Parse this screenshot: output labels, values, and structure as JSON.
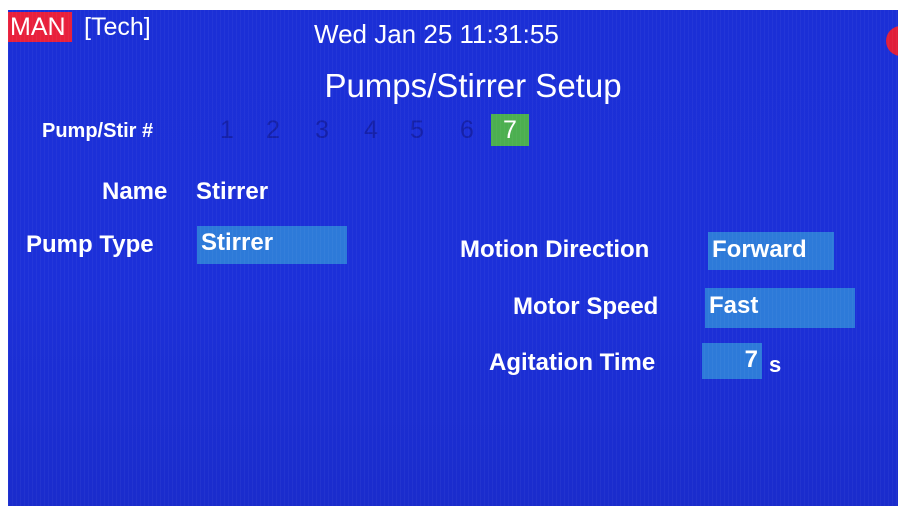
{
  "status_bar": {
    "mode": "MAN",
    "user": "[Tech]",
    "datetime": "Wed Jan 25 11:31:55"
  },
  "page": {
    "title": "Pumps/Stirrer Setup"
  },
  "pump_selector": {
    "label": "Pump/Stir #",
    "numbers": [
      "1",
      "2",
      "3",
      "4",
      "5",
      "6",
      "7"
    ],
    "selected": "7"
  },
  "fields": {
    "name": {
      "label": "Name",
      "value": "Stirrer"
    },
    "pump_type": {
      "label": "Pump Type",
      "value": "Stirrer"
    },
    "motion_direction": {
      "label": "Motion Direction",
      "value": "Forward"
    },
    "motor_speed": {
      "label": "Motor Speed",
      "value": "Fast"
    },
    "agitation_time": {
      "label": "Agitation Time",
      "value": "7",
      "unit": "s"
    }
  },
  "colors": {
    "screen_background": "#1b2fd6",
    "mode_badge": "#e8203c",
    "selected_number": "#4caf50",
    "value_box": "#2d7ad9",
    "alarm_indicator": "#e01e3a"
  },
  "icons": {
    "alarm": "alarm-indicator-dot"
  }
}
